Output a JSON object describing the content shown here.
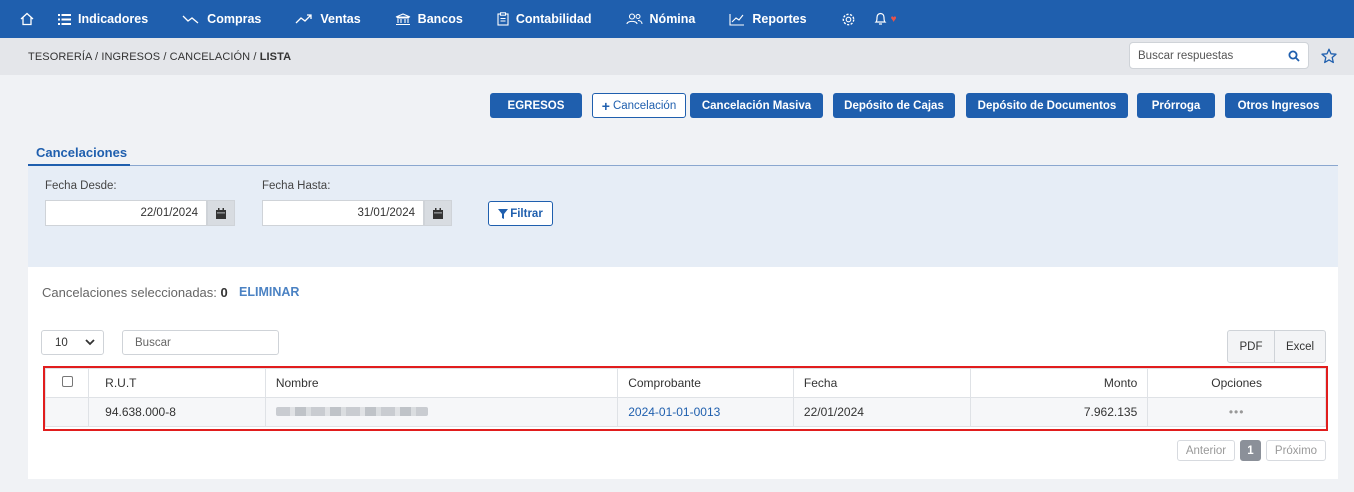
{
  "nav": {
    "items": [
      {
        "id": "indicadores",
        "label": "Indicadores",
        "icon": "list-icon"
      },
      {
        "id": "compras",
        "label": "Compras",
        "icon": "trend-down-icon"
      },
      {
        "id": "ventas",
        "label": "Ventas",
        "icon": "trend-up-icon"
      },
      {
        "id": "bancos",
        "label": "Bancos",
        "icon": "bank-icon"
      },
      {
        "id": "contabilidad",
        "label": "Contabilidad",
        "icon": "clipboard-icon"
      },
      {
        "id": "nomina",
        "label": "Nómina",
        "icon": "users-icon"
      },
      {
        "id": "reportes",
        "label": "Reportes",
        "icon": "chart-icon"
      }
    ],
    "badge": "♥"
  },
  "breadcrumb": {
    "path": "TESORERÍA / INGRESOS / CANCELACIÓN / ",
    "current": "LISTA"
  },
  "top_search": {
    "placeholder": "Buscar respuestas"
  },
  "actions": {
    "egresos": "EGRESOS",
    "cancelacion": "Cancelación",
    "cancelacion_masiva": "Cancelación Masiva",
    "deposito_cajas": "Depósito de Cajas",
    "deposito_documentos": "Depósito de Documentos",
    "prorroga": "Prórroga",
    "otros_ingresos": "Otros Ingresos"
  },
  "tab": {
    "label": "Cancelaciones"
  },
  "filter": {
    "desde_label": "Fecha Desde:",
    "desde_value": "22/01/2024",
    "hasta_label": "Fecha Hasta:",
    "hasta_value": "31/01/2024",
    "button": "Filtrar"
  },
  "selection": {
    "label": "Cancelaciones seleccionadas:",
    "count": "0",
    "delete": "ELIMINAR"
  },
  "table_controls": {
    "page_size": "10",
    "search_placeholder": "Buscar",
    "pdf": "PDF",
    "excel": "Excel"
  },
  "table": {
    "columns": [
      "R.U.T",
      "Nombre",
      "Comprobante",
      "Fecha",
      "Monto",
      "Opciones"
    ],
    "rows": [
      {
        "rut": "94.638.000-8",
        "comprobante": "2024-01-01-0013",
        "fecha": "22/01/2024",
        "monto": "7.962.135",
        "opciones": "•••"
      }
    ]
  },
  "pagination": {
    "prev": "Anterior",
    "current": "1",
    "next": "Próximo"
  },
  "colors": {
    "primary": "#1f5fae",
    "highlight": "#e11d1d"
  }
}
